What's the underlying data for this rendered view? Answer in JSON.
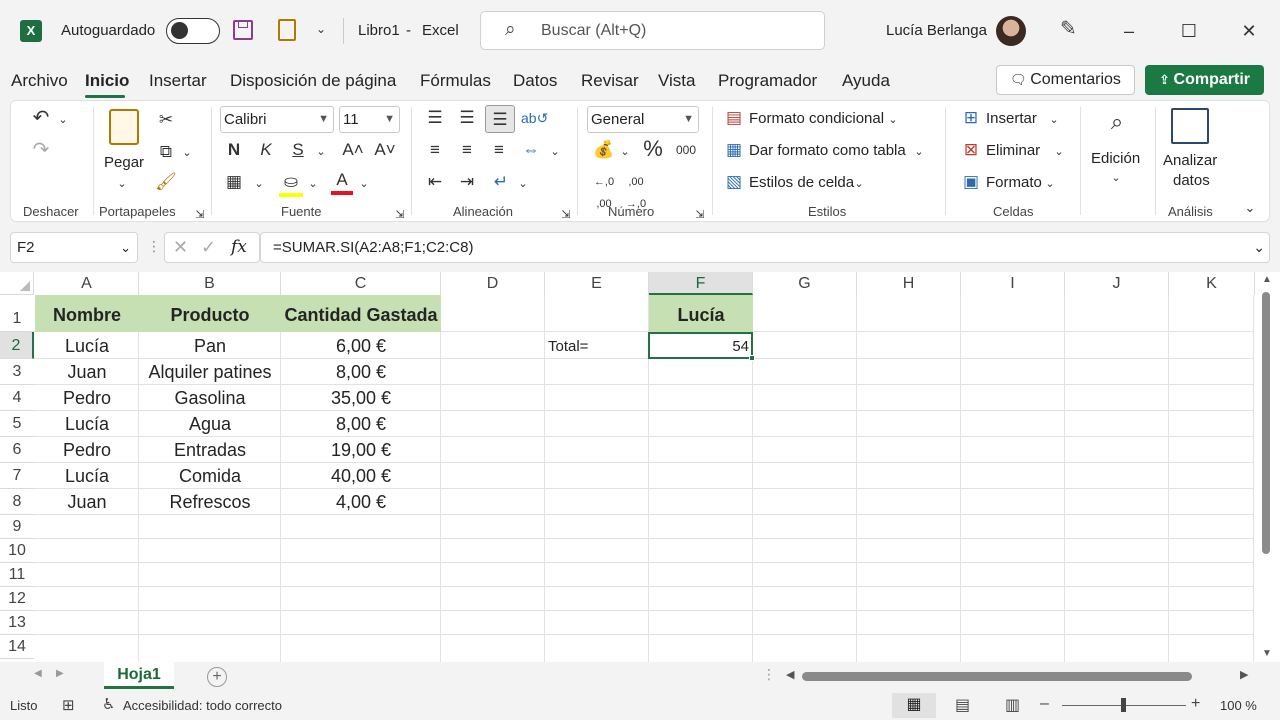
{
  "title_bar": {
    "autosave_label": "Autoguardado",
    "doc_title": "Libro1",
    "separator": "-",
    "app_name": "Excel",
    "search_placeholder": "Buscar (Alt+Q)",
    "user_name": "Lucía Berlanga"
  },
  "ribbon_tabs": [
    "Archivo",
    "Inicio",
    "Insertar",
    "Disposición de página",
    "Fórmulas",
    "Datos",
    "Revisar",
    "Vista",
    "Programador",
    "Ayuda"
  ],
  "active_tab": "Inicio",
  "buttons": {
    "comments": "Comentarios",
    "share": "Compartir"
  },
  "ribbon": {
    "undo_group": "Deshacer",
    "clipboard_group": "Portapapeles",
    "paste": "Pegar",
    "font_group": "Fuente",
    "font_name": "Calibri",
    "font_size": "11",
    "bold": "N",
    "italic": "K",
    "underline": "S",
    "align_group": "Alineación",
    "number_group": "Número",
    "number_format": "General",
    "styles_group": "Estilos",
    "conditional_format": "Formato condicional",
    "format_table": "Dar formato como tabla",
    "cell_styles": "Estilos de celda",
    "cells_group": "Celdas",
    "insert": "Insertar",
    "delete": "Eliminar",
    "format": "Formato",
    "editing": "Edición",
    "analyze_line1": "Analizar",
    "analyze_line2": "datos",
    "analysis_group": "Análisis"
  },
  "formula_bar": {
    "name_box": "F2",
    "formula": "=SUMAR.SI(A2:A8;F1;C2:C8)"
  },
  "columns": [
    "A",
    "B",
    "C",
    "D",
    "E",
    "F",
    "G",
    "H",
    "I",
    "J",
    "K"
  ],
  "rows": [
    "1",
    "2",
    "3",
    "4",
    "5",
    "6",
    "7",
    "8",
    "9",
    "10",
    "11",
    "12",
    "13",
    "14"
  ],
  "table": {
    "headers": [
      "Nombre",
      "Producto",
      "Cantidad Gastada"
    ],
    "data": [
      [
        "Lucía",
        "Pan",
        "6,00 €"
      ],
      [
        "Juan",
        "Alquiler patines",
        "8,00 €"
      ],
      [
        "Pedro",
        "Gasolina",
        "35,00 €"
      ],
      [
        "Lucía",
        "Agua",
        "8,00 €"
      ],
      [
        "Pedro",
        "Entradas",
        "19,00 €"
      ],
      [
        "Lucía",
        "Comida",
        "40,00 €"
      ],
      [
        "Juan",
        "Refrescos",
        "4,00 €"
      ]
    ]
  },
  "criteria_header": "Lucía",
  "total_label": "Total=",
  "total_value": "54",
  "sheet_tab": "Hoja1",
  "status": {
    "ready": "Listo",
    "accessibility": "Accesibilidad: todo correcto",
    "zoom": "100 %"
  },
  "colors": {
    "accent": "#217346",
    "header_fill": "#c6e0b4",
    "share_button": "#1b7a43"
  }
}
